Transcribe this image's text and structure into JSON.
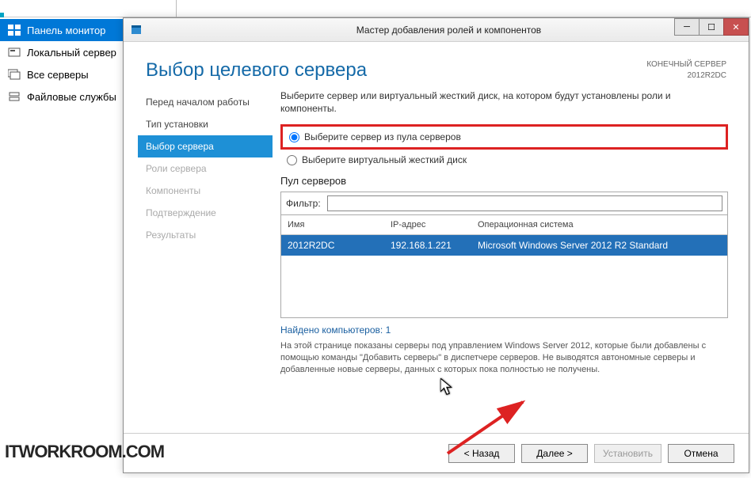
{
  "sm_nav": [
    {
      "label": "Панель монитор",
      "icon": "dashboard",
      "selected": true
    },
    {
      "label": "Локальный сервер",
      "icon": "server",
      "selected": false
    },
    {
      "label": "Все серверы",
      "icon": "servers",
      "selected": false
    },
    {
      "label": "Файловые службы",
      "icon": "files",
      "selected": false
    }
  ],
  "wizard": {
    "title": "Мастер добавления ролей и компонентов",
    "page_title": "Выбор целевого сервера",
    "dest_label": "КОНЕЧНЫЙ СЕРВЕР",
    "dest_value": "2012R2DC",
    "steps": [
      {
        "label": "Перед началом работы",
        "state": "done"
      },
      {
        "label": "Тип установки",
        "state": "done"
      },
      {
        "label": "Выбор сервера",
        "state": "active"
      },
      {
        "label": "Роли сервера",
        "state": "future"
      },
      {
        "label": "Компоненты",
        "state": "future"
      },
      {
        "label": "Подтверждение",
        "state": "future"
      },
      {
        "label": "Результаты",
        "state": "future"
      }
    ],
    "instruction": "Выберите сервер или виртуальный жесткий диск, на котором будут установлены роли и компоненты.",
    "radio1": "Выберите сервер из пула серверов",
    "radio2": "Выберите виртуальный жесткий диск",
    "pool_heading": "Пул серверов",
    "filter_label": "Фильтр:",
    "filter_value": "",
    "columns": {
      "name": "Имя",
      "ip": "IP-адрес",
      "os": "Операционная система"
    },
    "rows": [
      {
        "name": "2012R2DC",
        "ip": "192.168.1.221",
        "os": "Microsoft Windows Server 2012 R2 Standard"
      }
    ],
    "found_prefix": "Найдено компьютеров: ",
    "found_count": "1",
    "note": "На этой странице показаны серверы под управлением Windows Server 2012, которые были добавлены с помощью команды \"Добавить серверы\" в диспетчере серверов. Не выводятся автономные серверы и добавленные новые серверы, данных с которых пока полностью не получены.",
    "buttons": {
      "back": "< Назад",
      "next": "Далее >",
      "install": "Установить",
      "cancel": "Отмена"
    }
  },
  "watermark": "ITWORKROOM.COM"
}
